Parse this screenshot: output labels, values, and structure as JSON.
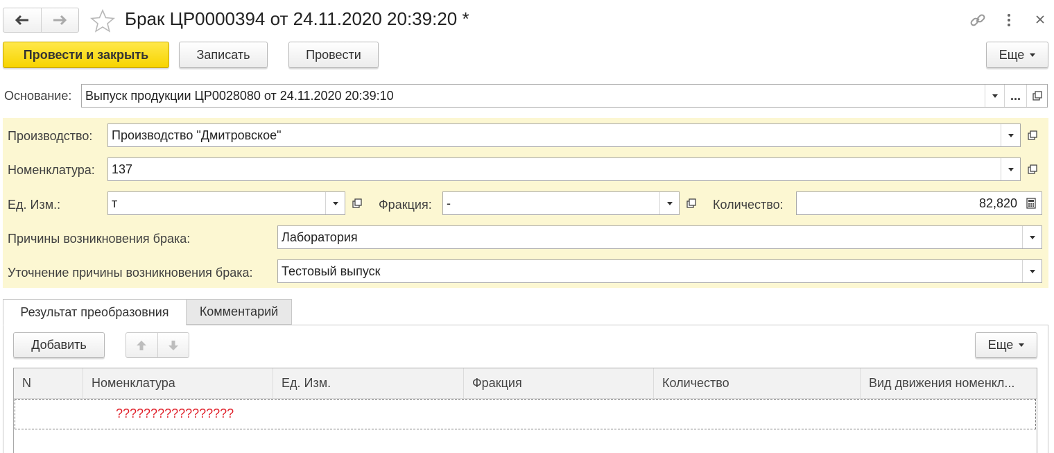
{
  "window": {
    "title": "Брак ЦР0000394 от 24.11.2020 20:39:20 *"
  },
  "toolbar": {
    "post_close": "Провести и закрыть",
    "save": "Записать",
    "post": "Провести",
    "more": "Еще"
  },
  "base": {
    "label": "Основание:",
    "value": "Выпуск продукции ЦР0028080 от 24.11.2020 20:39:10",
    "dots": "..."
  },
  "form": {
    "production_label": "Производство:",
    "production_value": "Производство \"Дмитровское\"",
    "nomenclature_label": "Номенклатура:",
    "nomenclature_value": "137",
    "unit_label": "Ед. Изм.:",
    "unit_value": "т",
    "fraction_label": "Фракция:",
    "fraction_value": "-",
    "qty_label": "Количество:",
    "qty_value": "82,820",
    "reason_label": "Причины возникновения брака:",
    "reason_value": "Лаборатория",
    "reason_detail_label": "Уточнение причины возникновения брака:",
    "reason_detail_value": "Тестовый выпуск"
  },
  "tabs": [
    {
      "label": "Результат преобразовния"
    },
    {
      "label": "Комментарий"
    }
  ],
  "table_toolbar": {
    "add": "Добавить",
    "more": "Еще"
  },
  "table": {
    "columns": [
      "N",
      "Номенклатура",
      "Ед. Изм.",
      "Фракция",
      "Количество",
      "Вид движения номенкл..."
    ],
    "rows": [
      {
        "nomenclature": "?????????????????"
      }
    ]
  },
  "colors": {
    "accent_yellow": "#f7d400",
    "panel_yellow": "#fcf7d2",
    "error_red": "#e0202a"
  }
}
